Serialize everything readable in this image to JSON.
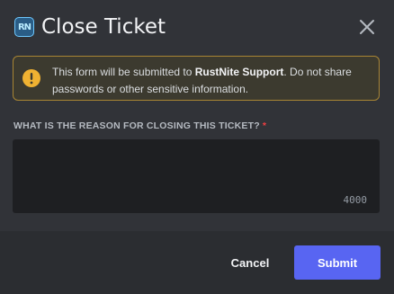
{
  "dialog": {
    "app_icon_label": "RN",
    "title": "Close Ticket"
  },
  "warning": {
    "text_before": "This form will be submitted to ",
    "bot_name": "RustNite Support",
    "text_after": ". Do not share passwords or other sensitive information."
  },
  "field": {
    "label": "WHAT IS THE REASON FOR CLOSING THIS TICKET?",
    "required_marker": "*",
    "value": "",
    "char_count": "4000"
  },
  "buttons": {
    "cancel": "Cancel",
    "submit": "Submit"
  },
  "icons": {
    "close": "close-icon",
    "warning": "warning-icon",
    "app": "rustnite-app-icon"
  },
  "colors": {
    "background": "#313338",
    "footer": "#2b2d31",
    "warning_border": "#a88534",
    "warning_icon": "#f0b232",
    "accent": "#5865f2",
    "required": "#f23f42"
  }
}
